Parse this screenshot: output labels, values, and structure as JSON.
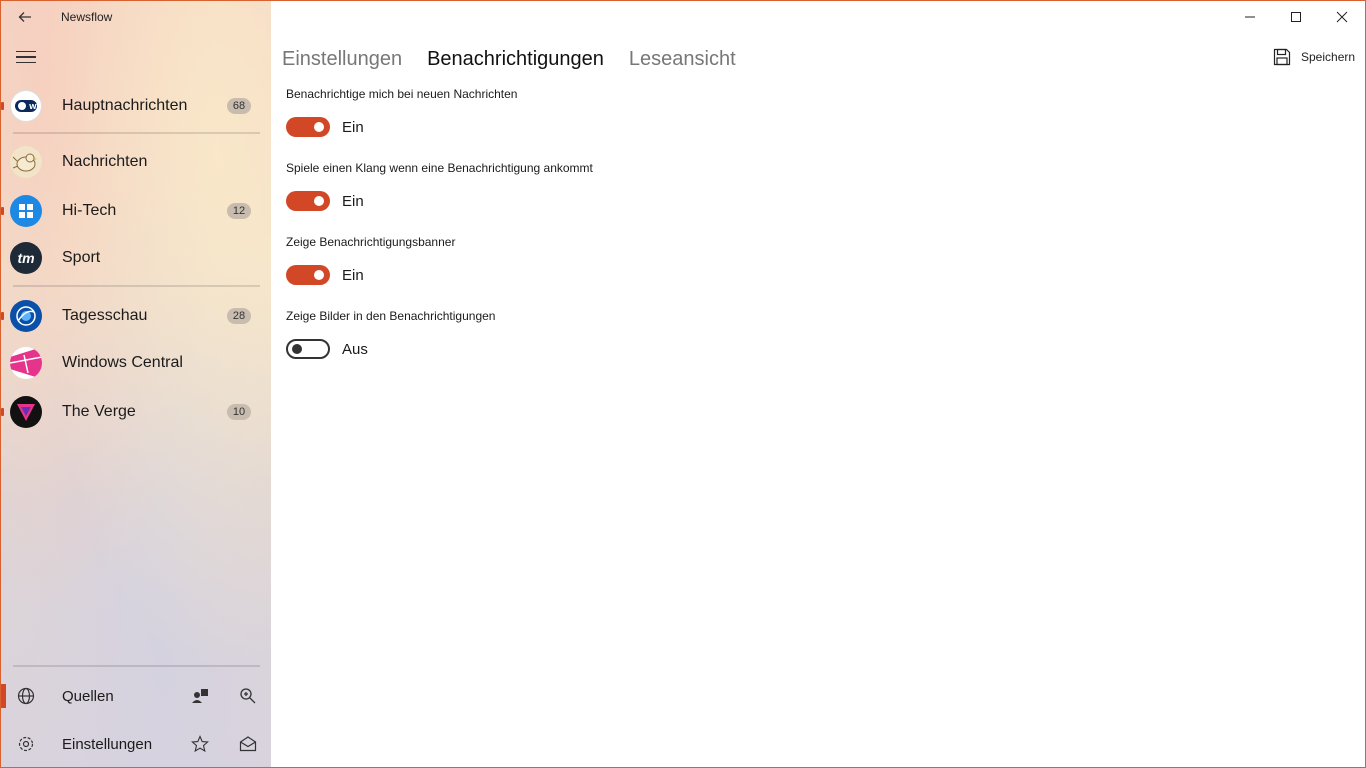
{
  "app": {
    "title": "Newsflow"
  },
  "colors": {
    "accent": "#d24726",
    "border": "#d9602f"
  },
  "sidebar": {
    "feeds": [
      {
        "label": "Hauptnachrichten",
        "badge": "68",
        "logo": "DW",
        "logo_color": "#0a2a5e"
      },
      {
        "label": "Nachrichten",
        "badge": "",
        "logo": "",
        "logo_color": "#e9d8b8"
      },
      {
        "label": "Hi-Tech",
        "badge": "12",
        "logo": "",
        "logo_color": "#1e88e5"
      },
      {
        "label": "Sport",
        "badge": "",
        "logo": "tm",
        "logo_color": "#1e2a38"
      },
      {
        "label": "Tagesschau",
        "badge": "28",
        "logo": "",
        "logo_color": "#0a4fa8"
      },
      {
        "label": "Windows Central",
        "badge": "",
        "logo": "",
        "logo_color": "#e6338c"
      },
      {
        "label": "The Verge",
        "badge": "10",
        "logo": "",
        "logo_color": "#111111"
      }
    ],
    "bottom": {
      "sources_label": "Quellen",
      "settings_label": "Einstellungen"
    }
  },
  "main": {
    "tabs": [
      {
        "label": "Einstellungen",
        "active": false
      },
      {
        "label": "Benachrichtigungen",
        "active": true
      },
      {
        "label": "Leseansicht",
        "active": false
      }
    ],
    "save_label": "Speichern",
    "settings": [
      {
        "label": "Benachrichtige mich bei neuen Nachrichten",
        "state": "Ein",
        "on": true
      },
      {
        "label": "Spiele einen Klang wenn eine Benachrichtigung ankommt",
        "state": "Ein",
        "on": true
      },
      {
        "label": "Zeige Benachrichtigungsbanner",
        "state": "Ein",
        "on": true
      },
      {
        "label": "Zeige Bilder in den Benachrichtigungen",
        "state": "Aus",
        "on": false
      }
    ]
  }
}
